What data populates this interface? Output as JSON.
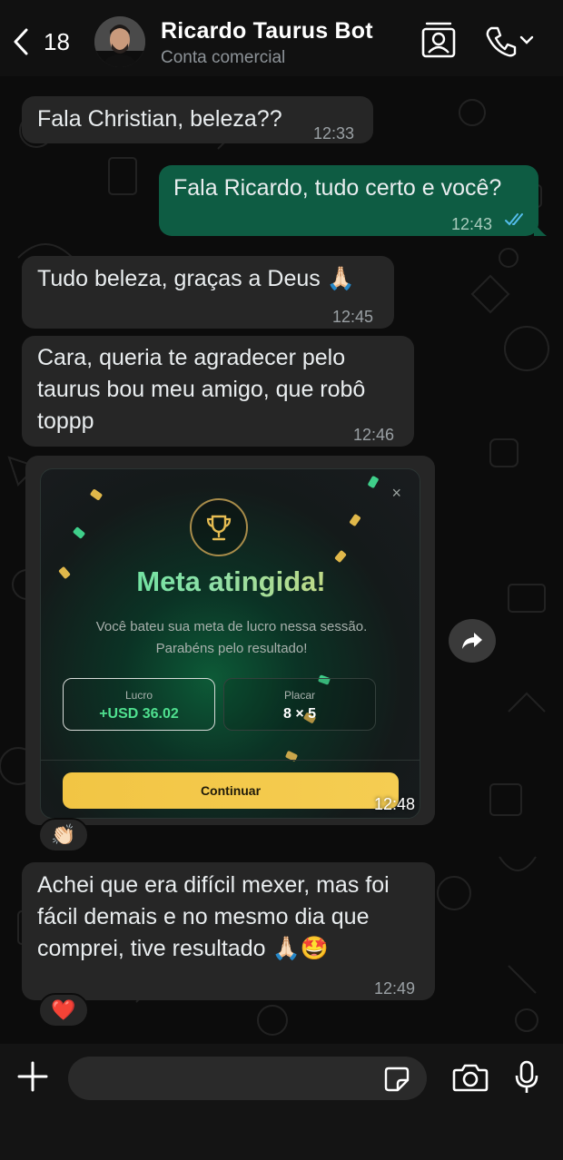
{
  "header": {
    "back_count": "18",
    "contact_name": "Ricardo Taurus Bot",
    "contact_subtitle": "Conta comercial"
  },
  "messages": [
    {
      "text": "Fala Christian, beleza??",
      "time": "12:33",
      "direction": "in"
    },
    {
      "text": "Fala Ricardo, tudo certo e você?",
      "time": "12:43",
      "direction": "out",
      "status": "read"
    },
    {
      "text": "Tudo beleza, graças a Deus 🙏🏻",
      "time": "12:45",
      "direction": "in"
    },
    {
      "text": "Cara, queria te agradecer pelo taurus bou meu amigo, que robô toppp",
      "time": "12:46",
      "direction": "in"
    },
    {
      "text": "Achei que era difícil mexer, mas foi fácil demais e no mesmo dia que comprei, tive resultado 🙏🏻🤩",
      "time": "12:49",
      "direction": "in"
    }
  ],
  "image_message": {
    "time": "12:48",
    "card": {
      "title": "Meta atingida!",
      "subtitle": "Você bateu sua meta de lucro nessa sessão. Parabéns pelo resultado!",
      "stat1_label": "Lucro",
      "stat1_value": "+USD 36.02",
      "stat2_label": "Placar",
      "stat2_value": "8 × 5",
      "button_label": "Continuar",
      "close_glyph": "×"
    },
    "reaction": "👏🏻"
  },
  "last_reaction": "❤️",
  "input": {
    "placeholder": ""
  },
  "colors": {
    "outgoing_bubble": "#0e5c43",
    "incoming_bubble": "#262626",
    "read_ticks": "#53bdeb",
    "accent_gold": "#f2c544",
    "profit_green": "#4fe08f"
  }
}
